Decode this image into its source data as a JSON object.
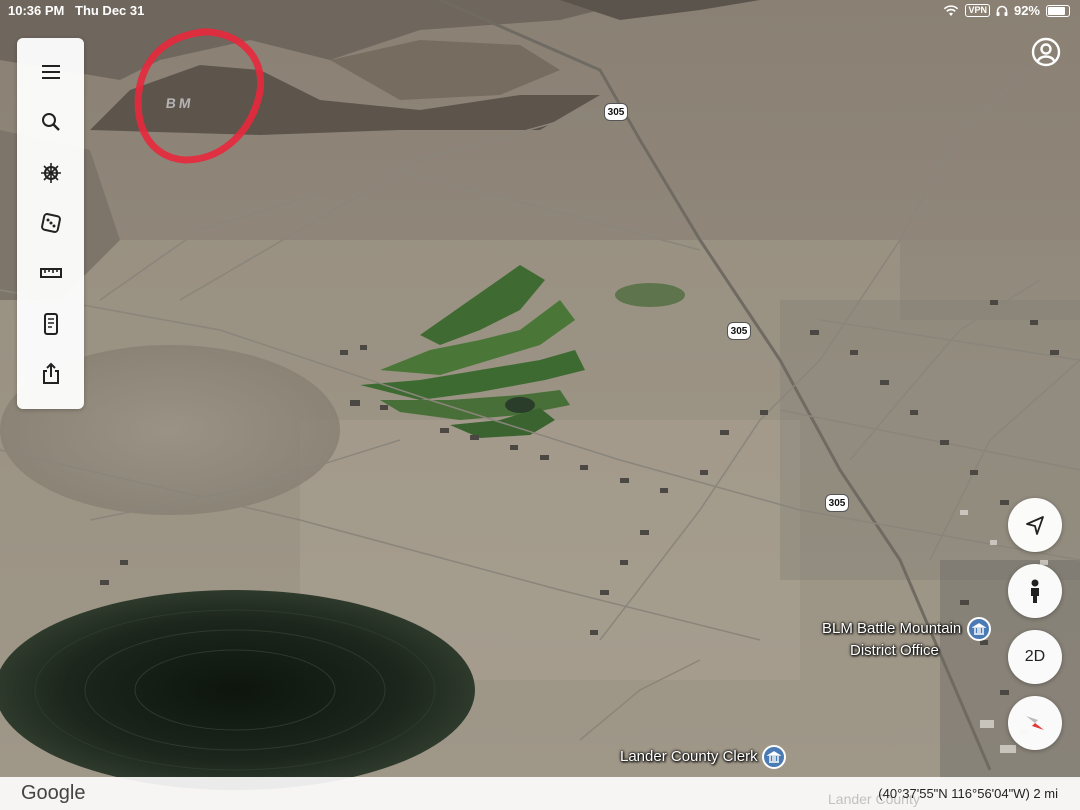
{
  "status_bar": {
    "time": "10:36 PM",
    "date": "Thu Dec 31",
    "vpn": "VPN",
    "battery": "92%",
    "battery_level": 0.92
  },
  "toolbar": {
    "items": [
      {
        "name": "menu-button",
        "icon": "menu-icon"
      },
      {
        "name": "search-button",
        "icon": "search-icon"
      },
      {
        "name": "voyager-button",
        "icon": "ships-wheel-icon"
      },
      {
        "name": "feeling-lucky-button",
        "icon": "dice-icon"
      },
      {
        "name": "measure-button",
        "icon": "ruler-icon"
      },
      {
        "name": "projects-button",
        "icon": "tablet-icon"
      },
      {
        "name": "share-button",
        "icon": "share-icon"
      }
    ]
  },
  "map": {
    "annotation_text": "BM",
    "annotation_color": "#e8283c",
    "road_shields": [
      "305",
      "305",
      "305"
    ],
    "places": {
      "blm": {
        "line1": "BLM Battle Mountain",
        "line2": "District Office",
        "icon": "government-building-icon"
      },
      "clerk": {
        "label": "Lander County Clerk",
        "icon": "government-building-icon"
      }
    }
  },
  "controls": {
    "location": {
      "icon": "location-arrow-icon"
    },
    "street_view": {
      "icon": "pegman-icon"
    },
    "view_toggle": {
      "label": "2D"
    },
    "compass": {
      "icon": "compass-icon"
    }
  },
  "footer": {
    "logo": "Google",
    "coordinates": "(40°37'55\"N 116°56'04\"W) 2 mi",
    "faded_label": "Lander County"
  }
}
